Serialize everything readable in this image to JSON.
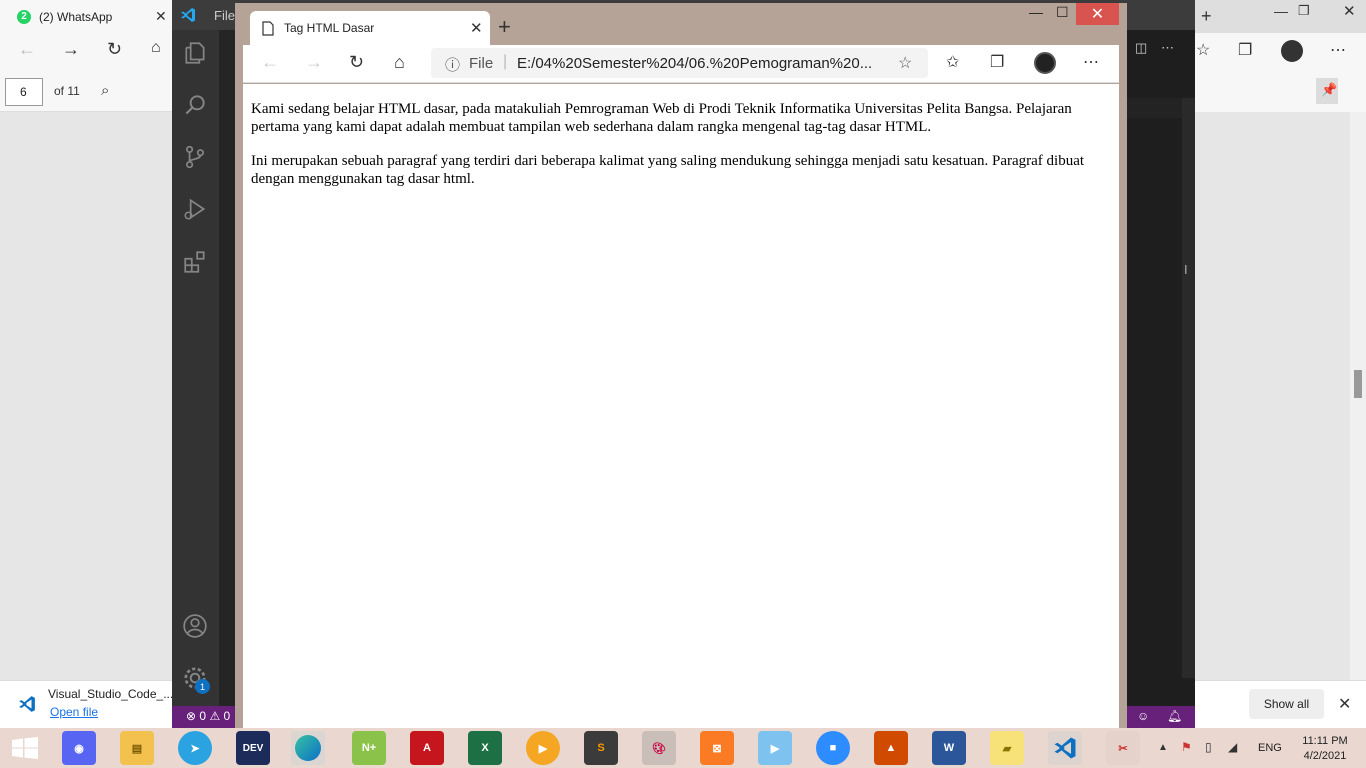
{
  "bg_browser": {
    "tab_title": "(2) WhatsApp",
    "tab_badge": "2",
    "pdf_page_number": "6",
    "pdf_page_total": "of 11"
  },
  "vscode": {
    "title_menu": "File",
    "status_errors": "0",
    "status_warnings": "0",
    "settings_badge": "1"
  },
  "edge": {
    "tab_title": "Tag HTML Dasar",
    "url_scheme": "File",
    "url": "E:/04%20Semester%204/06.%20Pemograman%20...",
    "paragraphs": [
      "Kami sedang belajar HTML dasar, pada matakuliah Pemrograman Web di Prodi Teknik Informatika Universitas Pelita Bangsa. Pelajaran pertama yang kami dapat adalah membuat tampilan web sederhana dalam rangka mengenal tag-tag dasar HTML.",
      "Ini merupakan sebuah paragraf yang terdiri dari beberapa kalimat yang saling mendukung sehingga menjadi satu kesatuan. Paragraf dibuat dengan menggunakan tag dasar html."
    ]
  },
  "download_bar": {
    "file_name": "Visual_Studio_Code_....exe",
    "open_label": "Open file",
    "show_all_label": "Show all"
  },
  "taskbar": {
    "language": "ENG",
    "time": "11:11 PM",
    "date": "4/2/2021",
    "apps": [
      "start",
      "discord",
      "file-explorer",
      "telegram",
      "dev-cpp",
      "edge",
      "notepad-plus",
      "acrobat",
      "excel",
      "media-player",
      "sublime",
      "paint",
      "xampp",
      "video-editor",
      "zoom",
      "matlab",
      "word",
      "sticky-notes",
      "vscode",
      "snipping-tool"
    ]
  },
  "colors": {
    "vscode_status": "#68217a",
    "edge_frame": "#b5a397",
    "taskbar": "#e9d7d0"
  }
}
